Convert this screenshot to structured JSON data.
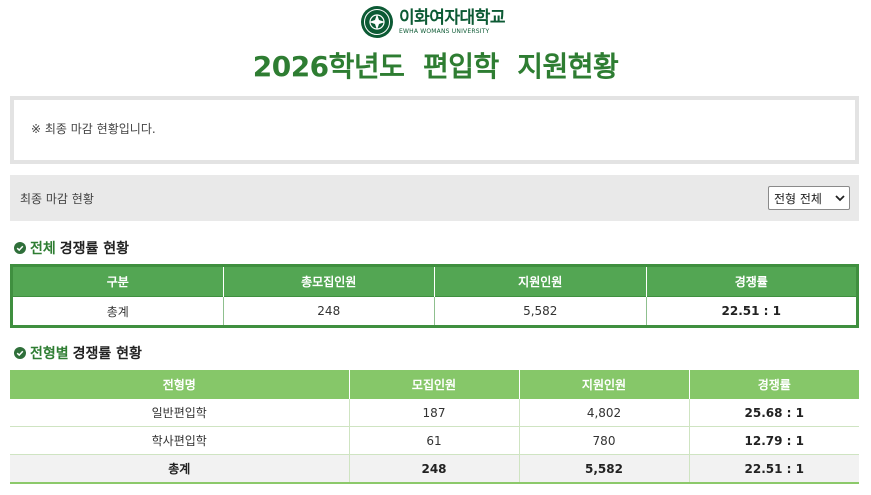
{
  "header": {
    "logo_korean": "이화여자대학교",
    "logo_english": "EWHA WOMANS UNIVERSITY",
    "page_title": "2026학년도  편입학  지원현황"
  },
  "notice": {
    "text": "※ 최종 마감 현황입니다."
  },
  "filter_bar": {
    "label": "최종 마감 현황",
    "select_value": "전형 전체"
  },
  "overall_section": {
    "title_highlight": "전체",
    "title_rest": "경쟁률 현황",
    "headers": [
      "구분",
      "총모집인원",
      "지원인원",
      "경쟁률"
    ],
    "row": {
      "category": "총계",
      "quota": "248",
      "applicants": "5,582",
      "ratio": "22.51 : 1"
    }
  },
  "type_section": {
    "title_highlight": "전형별",
    "title_rest": "경쟁률 현황",
    "headers": [
      "전형명",
      "모집인원",
      "지원인원",
      "경쟁률"
    ],
    "rows": [
      {
        "name": "일반편입학",
        "quota": "187",
        "applicants": "4,802",
        "ratio": "25.68 : 1"
      },
      {
        "name": "학사편입학",
        "quota": "61",
        "applicants": "780",
        "ratio": "12.79 : 1"
      }
    ],
    "total": {
      "name": "총계",
      "quota": "248",
      "applicants": "5,582",
      "ratio": "22.51 : 1"
    }
  },
  "colors": {
    "title_green": "#2e7d32",
    "header_dark_green": "#53a653",
    "header_light_green": "#86c769",
    "logo_green": "#0c5a34"
  },
  "icons": {
    "logo": "ewha-emblem-icon",
    "section": "check-circle-icon",
    "select": "chevron-down-icon"
  }
}
